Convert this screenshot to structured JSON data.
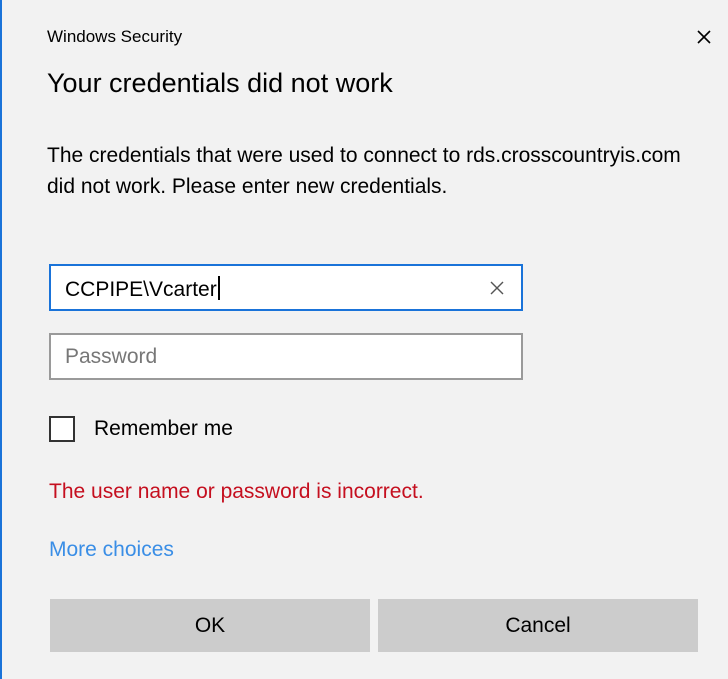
{
  "window": {
    "caption": "Windows Security",
    "close_icon": "close-icon"
  },
  "dialog": {
    "heading": "Your credentials did not work",
    "message": "The credentials that were used to connect to rds.crosscountryis.com did not work. Please enter new credentials."
  },
  "username": {
    "value": "CCPIPE\\Vcarter",
    "clear_icon": "clear-icon"
  },
  "password": {
    "value": "",
    "placeholder": "Password"
  },
  "remember": {
    "label": "Remember me",
    "checked": false
  },
  "error": {
    "text": "The user name or password is incorrect."
  },
  "links": {
    "more_choices": "More choices"
  },
  "buttons": {
    "ok": "OK",
    "cancel": "Cancel"
  },
  "colors": {
    "accent": "#1a73d9",
    "error": "#c50f1f",
    "link": "#3a8ee6",
    "button_bg": "#cccccc",
    "dialog_bg": "#f2f2f2"
  }
}
